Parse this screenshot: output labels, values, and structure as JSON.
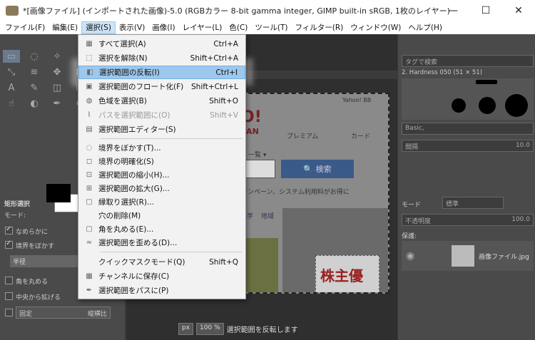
{
  "window": {
    "title": "*[画像ファイル] (インポートされた画像)-5.0 (RGBカラー 8-bit gamma integer, GIMP built-in sRGB, 1枚のレイヤー) 358x299 – GI...",
    "minimize": "—",
    "maximize": "☐",
    "close": "✕"
  },
  "menubar": {
    "items": [
      "ファイル(F)",
      "編集(E)",
      "選択(S)",
      "表示(V)",
      "画像(I)",
      "レイヤー(L)",
      "色(C)",
      "ツール(T)",
      "フィルター(R)",
      "ウィンドウ(W)",
      "ヘルプ(H)"
    ],
    "active_index": 2
  },
  "select_menu": {
    "items": [
      {
        "label": "すべて選択(A)",
        "shortcut": "Ctrl+A",
        "enabled": true
      },
      {
        "label": "選択を解除(N)",
        "shortcut": "Shift+Ctrl+A",
        "enabled": true
      },
      {
        "label": "選択範囲の反転(I)",
        "shortcut": "Ctrl+I",
        "enabled": true,
        "highlighted": true
      },
      {
        "label": "選択範囲のフロート化(F)",
        "shortcut": "Shift+Ctrl+L",
        "enabled": true
      },
      {
        "label": "色域を選択(B)",
        "shortcut": "Shift+O",
        "enabled": true
      },
      {
        "label": "パスを選択範囲に(O)",
        "shortcut": "Shift+V",
        "enabled": false
      },
      {
        "label": "選択範囲エディター(S)",
        "shortcut": "",
        "enabled": true
      },
      {
        "label": "境界をぼかす(T)...",
        "shortcut": "",
        "enabled": true
      },
      {
        "label": "境界の明確化(S)",
        "shortcut": "",
        "enabled": true
      },
      {
        "label": "選択範囲の縮小(H)...",
        "shortcut": "",
        "enabled": true
      },
      {
        "label": "選択範囲の拡大(G)...",
        "shortcut": "",
        "enabled": true
      },
      {
        "label": "縁取り選択(R)...",
        "shortcut": "",
        "enabled": true
      },
      {
        "label": "穴の削除(M)",
        "shortcut": "",
        "enabled": true
      },
      {
        "label": "角を丸める(E)...",
        "shortcut": "",
        "enabled": true
      },
      {
        "label": "選択範囲を歪める(D)...",
        "shortcut": "",
        "enabled": true
      },
      {
        "label": "クイックマスクモード(Q)",
        "shortcut": "Shift+Q",
        "enabled": true
      },
      {
        "label": "チャンネルに保存(C)",
        "shortcut": "",
        "enabled": true
      },
      {
        "label": "選択範囲をパスに(P)",
        "shortcut": "",
        "enabled": true
      }
    ]
  },
  "tool_options": {
    "title": "矩形選択",
    "mode_label": "モード:",
    "antialias": "なめらかに",
    "feather": "境界をぼかす",
    "radius": "半径",
    "rounded": "角を丸める",
    "expand_center": "中央から拡げる",
    "fixed": "固定",
    "fixed_value": "縦横比"
  },
  "canvas": {
    "ruler_value": "50",
    "yahoo_label": "Yahoo! BB",
    "logo": "O!",
    "logo_sub": "PAN",
    "premium": "プレミアム",
    "card": "カード",
    "search_button": "🔍 検索",
    "list_label": "一覧 ▾",
    "campaign": "品キャンペーン、システム利用料がお得に",
    "tabs": [
      "学",
      "地域"
    ],
    "kabu": "株主優"
  },
  "statusbar": {
    "unit": "px",
    "zoom": "100 %",
    "message": "選択範囲を反転します"
  },
  "dock": {
    "tag_placeholder": "タグで検索",
    "brush_name": "2. Hardness 050 (51 × 51)",
    "preset": "Basic,",
    "spacing_label": "間隔",
    "spacing_value": "10.0",
    "mode_label": "モード",
    "mode_value": "標準",
    "opacity_label": "不透明度",
    "opacity_value": "100.0",
    "protect_label": "保護:",
    "layer_name": "画像ファイル.jpg"
  }
}
